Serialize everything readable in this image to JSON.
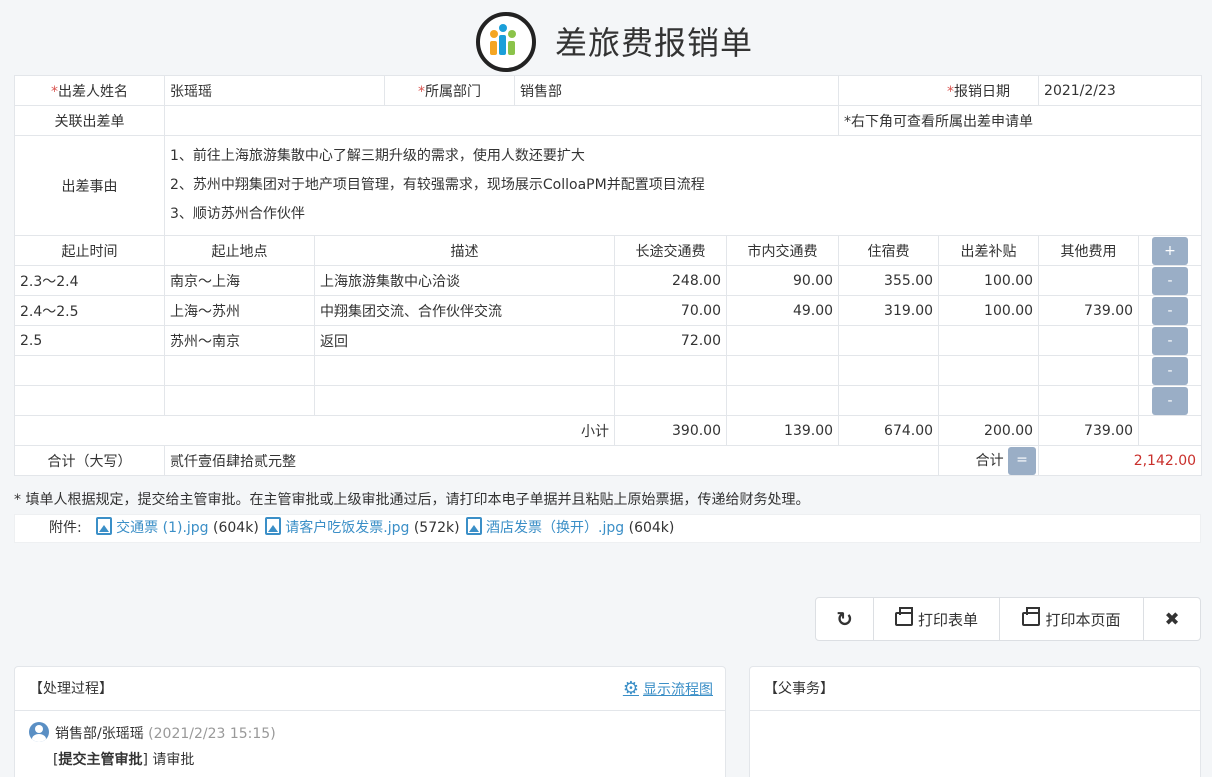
{
  "header": {
    "title": "差旅费报销单"
  },
  "form": {
    "traveler_label": "出差人姓名",
    "traveler_value": "张瑶瑶",
    "dept_label": "所属部门",
    "dept_value": "销售部",
    "date_label": "报销日期",
    "date_value": "2021/2/23",
    "related_label": "关联出差单",
    "related_hint": "*右下角可查看所属出差申请单",
    "reason_label": "出差事由",
    "reason_lines": [
      "1、前往上海旅游集散中心了解三期升级的需求，使用人数还要扩大",
      "2、苏州中翔集团对于地产项目管理，有较强需求，现场展示ColloaPM并配置项目流程",
      "3、顺访苏州合作伙伴"
    ]
  },
  "expense_table": {
    "columns": [
      "起止时间",
      "起止地点",
      "描述",
      "长途交通费",
      "市内交通费",
      "住宿费",
      "出差补贴",
      "其他费用"
    ],
    "add_label": "+",
    "remove_label": "-",
    "rows": [
      [
        "2.3～2.4",
        "南京～上海",
        "上海旅游集散中心洽谈",
        "248.00",
        "90.00",
        "355.00",
        "100.00",
        ""
      ],
      [
        "2.4～2.5",
        "上海～苏州",
        "中翔集团交流、合作伙伴交流",
        "70.00",
        "49.00",
        "319.00",
        "100.00",
        "739.00"
      ],
      [
        "2.5",
        "苏州～南京",
        "返回",
        "72.00",
        "",
        "",
        "",
        ""
      ],
      [
        "",
        "",
        "",
        "",
        "",
        "",
        "",
        ""
      ],
      [
        "",
        "",
        "",
        "",
        "",
        "",
        "",
        ""
      ]
    ],
    "subtotal_label": "小计",
    "subtotals": [
      "390.00",
      "139.00",
      "674.00",
      "200.00",
      "739.00"
    ],
    "total_caps_label": "合计（大写）",
    "total_caps_value": "贰仟壹佰肆拾贰元整",
    "total_label": "合计",
    "eq_label": "=",
    "total_value": "2,142.00"
  },
  "note": "* 填单人根据规定，提交给主管审批。在主管审批或上级审批通过后，请打印本电子单据并且粘贴上原始票据，传递给财务处理。",
  "attachments": {
    "label": "附件:",
    "files": [
      {
        "name": "交通票 (1).jpg",
        "size": "(604k)"
      },
      {
        "name": "请客户吃饭发票.jpg",
        "size": "(572k)"
      },
      {
        "name": "酒店发票（换开）.jpg",
        "size": "(604k)"
      }
    ]
  },
  "toolbar": {
    "refresh_icon": "↻",
    "print_form_label": "打印表单",
    "print_page_label": "打印本页面",
    "close_icon": "✖"
  },
  "process_panel": {
    "title": "【处理过程】",
    "flow_link": "显示流程图",
    "entry_user": "销售部/张瑶瑶",
    "entry_time": "(2021/2/23 15:15)",
    "entry_action": "提交主管审批",
    "entry_comment": "请审批"
  },
  "parent_panel": {
    "title": "【父事务】"
  }
}
